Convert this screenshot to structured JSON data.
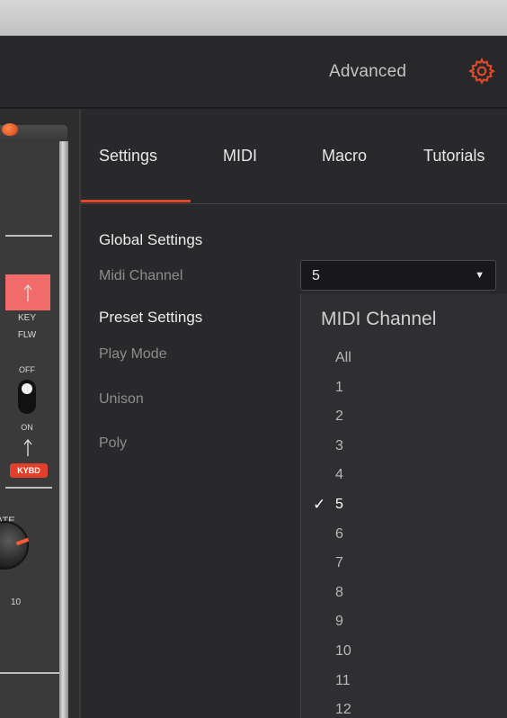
{
  "header": {
    "title": "Advanced",
    "gear_icon": "gear-icon",
    "accent": "#e04a2a"
  },
  "synth": {
    "key_label": "KEY",
    "flw_label": "FLW",
    "off_label": "OFF",
    "on_label": "ON",
    "kybd_label": "KYBD",
    "rate_label": "ATE",
    "knob_value": "10"
  },
  "tabs": [
    {
      "label": "Settings",
      "active": true
    },
    {
      "label": "MIDI",
      "active": false
    },
    {
      "label": "Macro",
      "active": false
    },
    {
      "label": "Tutorials",
      "active": false
    }
  ],
  "global": {
    "title": "Global Settings",
    "midi_channel_label": "Midi Channel",
    "midi_channel_value": "5"
  },
  "preset": {
    "title": "Preset Settings",
    "play_mode_label": "Play Mode",
    "unison_label": "Unison",
    "poly_label": "Poly"
  },
  "dropdown": {
    "header": "MIDI Channel",
    "selected": "5",
    "options": [
      "All",
      "1",
      "2",
      "3",
      "4",
      "5",
      "6",
      "7",
      "8",
      "9",
      "10",
      "11",
      "12"
    ]
  }
}
